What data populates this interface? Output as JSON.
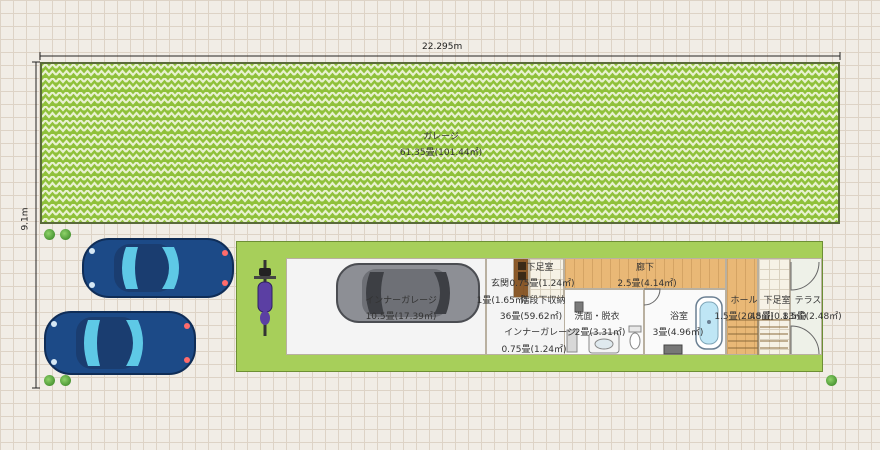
{
  "dimensions": {
    "width_label": "22.295m",
    "height_label": "9.1m"
  },
  "rooms": {
    "garage": {
      "name": "ガレージ",
      "area": "61.35畳(101.44㎡)"
    },
    "inner_garage": {
      "name": "インナーガレージ",
      "area": "10.5畳(17.39㎡)"
    },
    "entrance": {
      "name": "玄関",
      "area": "0.75畳(1.24㎡)"
    },
    "shoe_room": {
      "name": "下足室",
      "area": "0.75畳(1.24㎡)"
    },
    "corridor": {
      "name": "廊下",
      "area": "2.5畳(4.14㎡)"
    },
    "stair_storage": {
      "name": "階段下収納",
      "area": "1畳(1.65㎡)"
    },
    "overlap_text": "36畳(59.62㎡)",
    "inner_garage_2": {
      "name": "インナーガレージ",
      "area": "0.75畳(1.24㎡)"
    },
    "washroom": {
      "name": "洗面・脱衣",
      "area": "2畳(3.31㎡)"
    },
    "bathroom": {
      "name": "浴室",
      "area": "3畳(4.96㎡)"
    },
    "hall": {
      "name": "ホール",
      "area": "1.5畳(2.48㎡)"
    },
    "shoe_room_2": {
      "name": "下足室",
      "area": "0.5畳(0.83㎡)"
    },
    "terrace": {
      "name": "テラス",
      "area": "1.5畳(2.48㎡)"
    }
  },
  "colors": {
    "garage_green": "#8fc13a",
    "zigzag_white": "#e8f1cf",
    "lawn_green": "#a7cf5a",
    "car_blue": "#1c4a87",
    "car_gray": "#8d8f95",
    "bike_purple": "#5b3fa3"
  },
  "icons": [
    "tree-icon",
    "car-icon",
    "motorcycle-icon",
    "bathtub-icon",
    "toilet-icon",
    "sink-icon",
    "door-swing-icon",
    "stairs-icon"
  ]
}
